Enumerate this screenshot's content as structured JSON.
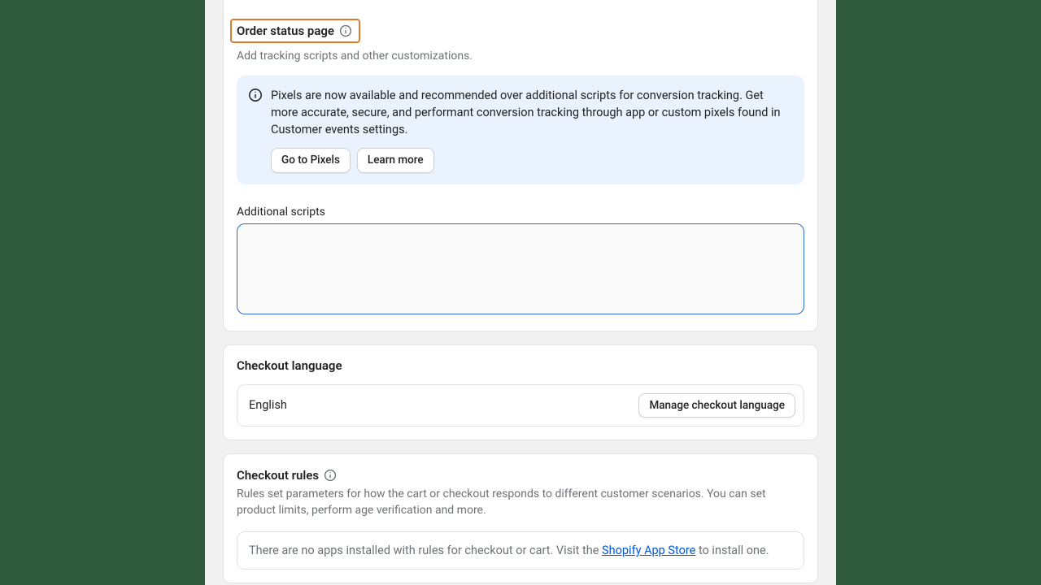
{
  "order_status": {
    "heading": "Order status page",
    "subtext": "Add tracking scripts and other customizations.",
    "banner_text": "Pixels are now available and recommended over additional scripts for conversion tracking. Get more accurate, secure, and performant conversion tracking through app or custom pixels found in Customer events settings.",
    "go_to_pixels": "Go to Pixels",
    "learn_more": "Learn more",
    "scripts_label": "Additional scripts",
    "scripts_value": ""
  },
  "checkout_language": {
    "heading": "Checkout language",
    "value": "English",
    "manage_button": "Manage checkout language"
  },
  "checkout_rules": {
    "heading": "Checkout rules",
    "subtext": "Rules set parameters for how the cart or checkout responds to different customer scenarios. You can set product limits, perform age verification and more.",
    "empty_prefix": "There are no apps installed with rules for checkout or cart. Visit the ",
    "link_text": "Shopify App Store",
    "empty_suffix": " to install one."
  }
}
